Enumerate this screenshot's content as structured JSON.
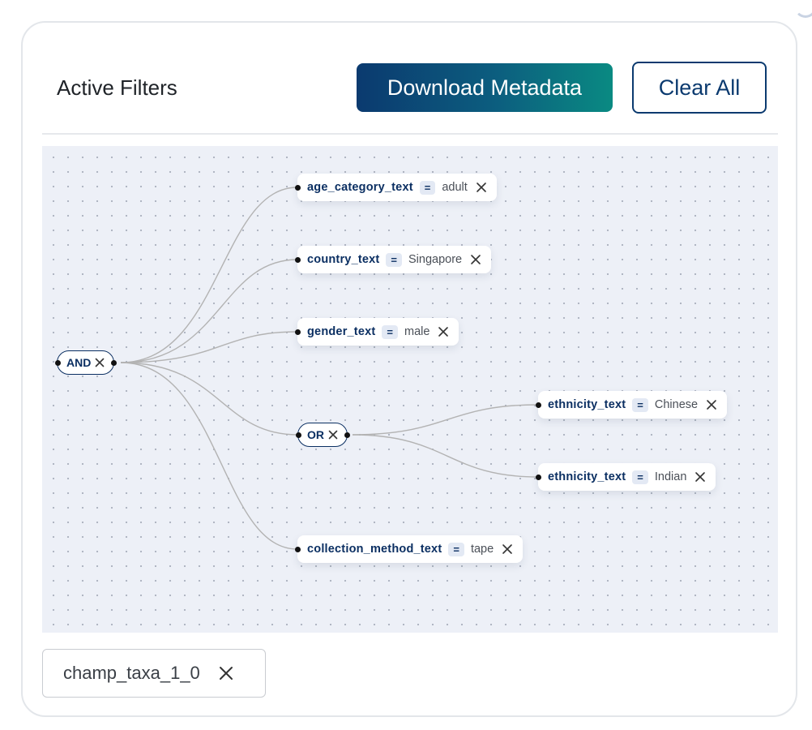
{
  "panel": {
    "title": "Active Filters",
    "download_label": "Download Metadata",
    "clear_label": "Clear All"
  },
  "tree": {
    "root": {
      "label": "AND"
    },
    "conditions": [
      {
        "field": "age_category_text",
        "op": "=",
        "value": "adult"
      },
      {
        "field": "country_text",
        "op": "=",
        "value": "Singapore"
      },
      {
        "field": "gender_text",
        "op": "=",
        "value": "male"
      },
      {
        "field": "collection_method_text",
        "op": "=",
        "value": "tape"
      }
    ],
    "or_group": {
      "label": "OR",
      "conditions": [
        {
          "field": "ethnicity_text",
          "op": "=",
          "value": "Chinese"
        },
        {
          "field": "ethnicity_text",
          "op": "=",
          "value": "Indian"
        }
      ]
    }
  },
  "chips": [
    {
      "label": "champ_taxa_1_0"
    }
  ],
  "colors": {
    "navy": "#0b2f62",
    "gradient_start": "#0b3a6f",
    "gradient_end": "#0a8a82",
    "canvas_bg": "#edf0f7",
    "edge": "#b3b3b3"
  },
  "icons": {
    "remove": "close-icon"
  }
}
